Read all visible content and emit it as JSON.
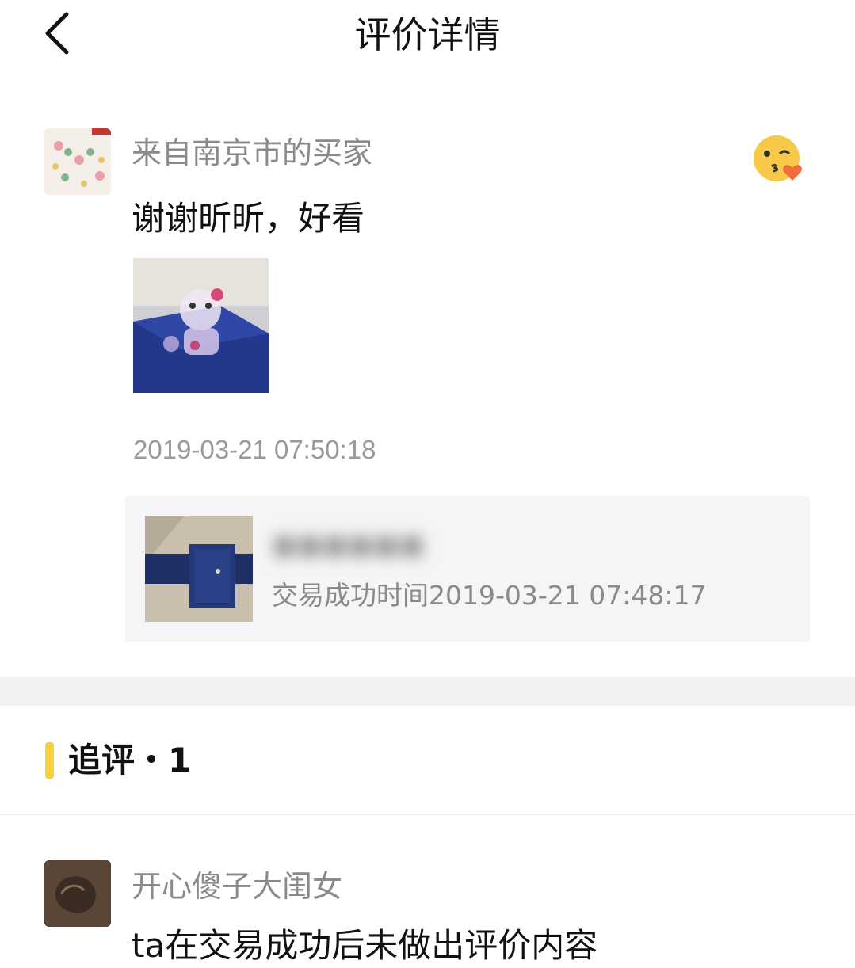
{
  "header": {
    "title": "评价详情",
    "back_icon": "chevron-left-icon"
  },
  "review": {
    "username": "来自南京市的买家",
    "emoji_icon": "kiss-face-emoji-icon",
    "text": "谢谢昕昕，好看",
    "timestamp": "2019-03-21 07:50:18",
    "product": {
      "name": "■■■■■■",
      "trade_time": "交易成功时间2019-03-21 07:48:17"
    }
  },
  "followup_section": {
    "title": "追评・1",
    "accent_color": "#f5d23c"
  },
  "followup": {
    "username": "开心傻子大闺女",
    "text": "ta在交易成功后未做出评价内容"
  }
}
